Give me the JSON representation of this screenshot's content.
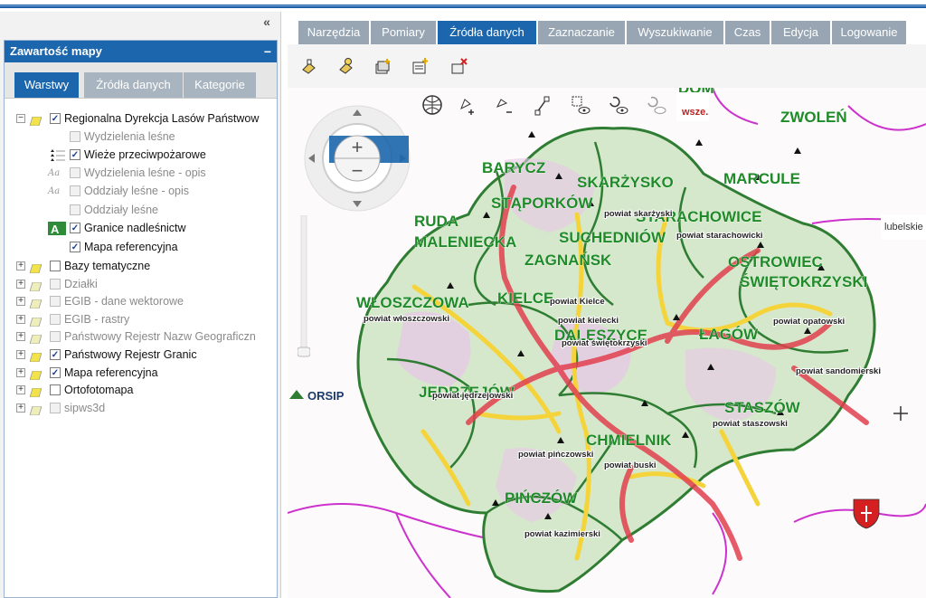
{
  "colors": {
    "accent": "#1b66ad",
    "tab_inactive": "#98a6b4",
    "region_green": "#2e7d32",
    "road_yellow": "#f5d33b",
    "road_red": "#e0404e",
    "boundary_magenta": "#cc33cc"
  },
  "toolbar": {
    "collapse_label": "«",
    "tabs": [
      {
        "label": "Narzędzia"
      },
      {
        "label": "Pomiary"
      },
      {
        "label": "Źródła danych"
      },
      {
        "label": "Zaznaczanie"
      },
      {
        "label": "Wyszukiwanie"
      },
      {
        "label": "Czas"
      },
      {
        "label": "Edycja"
      },
      {
        "label": "Logowanie"
      }
    ],
    "active_tab": "Źródła danych",
    "tool_icons": [
      "layer-edit-icon",
      "layer-settings-icon",
      "add-layer-icon",
      "add-wms-icon",
      "remove-layer-icon"
    ],
    "map_tool_icons": [
      "globe-icon",
      "add-point-icon",
      "remove-point-icon",
      "draw-line-icon",
      "select-area-icon",
      "view-icon",
      "view-hide-icon"
    ]
  },
  "panel": {
    "title": "Zawartość mapy",
    "minimize_label": "−",
    "tabs": [
      {
        "label": "Warstwy"
      },
      {
        "label": "Źródła danych"
      },
      {
        "label": "Kategorie"
      }
    ],
    "active_tab": "Warstwy"
  },
  "layers": [
    {
      "label": "Regionalna Dyrekcja Lasów Państwow",
      "checked": true,
      "enabled": true,
      "expand": "−"
    },
    {
      "label": "Wydzielenia leśne",
      "checked": false,
      "enabled": false
    },
    {
      "label": "Wieże przeciwpożarowe",
      "checked": true,
      "enabled": true
    },
    {
      "label": "Wydzielenia leśne - opis",
      "checked": false,
      "enabled": false
    },
    {
      "label": "Oddziały leśne - opis",
      "checked": false,
      "enabled": false
    },
    {
      "label": "Oddziały leśne",
      "checked": false,
      "enabled": false
    },
    {
      "label": "Granice nadleśnictw",
      "checked": true,
      "enabled": true
    },
    {
      "label": "Mapa referencyjna",
      "checked": true,
      "enabled": true
    },
    {
      "label": "Bazy tematyczne",
      "checked": false,
      "enabled": true,
      "expand": "+"
    },
    {
      "label": "Działki",
      "checked": false,
      "enabled": false,
      "expand": "+"
    },
    {
      "label": "EGIB - dane wektorowe",
      "checked": false,
      "enabled": false,
      "expand": "+"
    },
    {
      "label": "EGIB - rastry",
      "checked": false,
      "enabled": false,
      "expand": "+"
    },
    {
      "label": "Państwowy Rejestr Nazw Geograficzn",
      "checked": false,
      "enabled": false,
      "expand": "+"
    },
    {
      "label": "Państwowy Rejestr Granic",
      "checked": true,
      "enabled": true,
      "expand": "+"
    },
    {
      "label": "Mapa referencyjna",
      "checked": true,
      "enabled": true,
      "expand": "+"
    },
    {
      "label": "Ortofotomapa",
      "checked": false,
      "enabled": true,
      "expand": "+"
    },
    {
      "label": "sipws3d",
      "checked": false,
      "enabled": false,
      "expand": "+"
    }
  ],
  "map": {
    "labels": [
      "DOM",
      "ZWOLEŃ",
      "BARYCZ",
      "SKARŻYSKO",
      "MARCULE",
      "STĄPORKÓW",
      "STARACHOWICE",
      "RUDA",
      "MALENIECKA",
      "SUCHEDNIÓW",
      "ZAGNAŃSK",
      "OSTROWIEC",
      "ŚWIĘTOKRZYSKI",
      "WŁOSZCZOWA",
      "KIELCE",
      "DALESZYCE",
      "ŁAGÓW",
      "JĘDRZEJÓW",
      "STASZÓW",
      "CHMIELNIK",
      "PIŃCZÓW"
    ],
    "counties": [
      "powiat skarżyski",
      "powiat starachowicki",
      "powiat opatowski",
      "powiat Kielce",
      "powiat kielecki",
      "powiat świętokrzyski",
      "powiat włoszczowski",
      "powiat jędrzejowski",
      "powiat sandomierski",
      "powiat staszowski",
      "powiat pińczowski",
      "powiat buski",
      "powiat kazimierski"
    ],
    "logo_orsip": "ORSIP",
    "logo_lubelskie": "lubelskie",
    "logo_wsze": "wsze.",
    "zoom_in": "+",
    "zoom_out": "−"
  }
}
